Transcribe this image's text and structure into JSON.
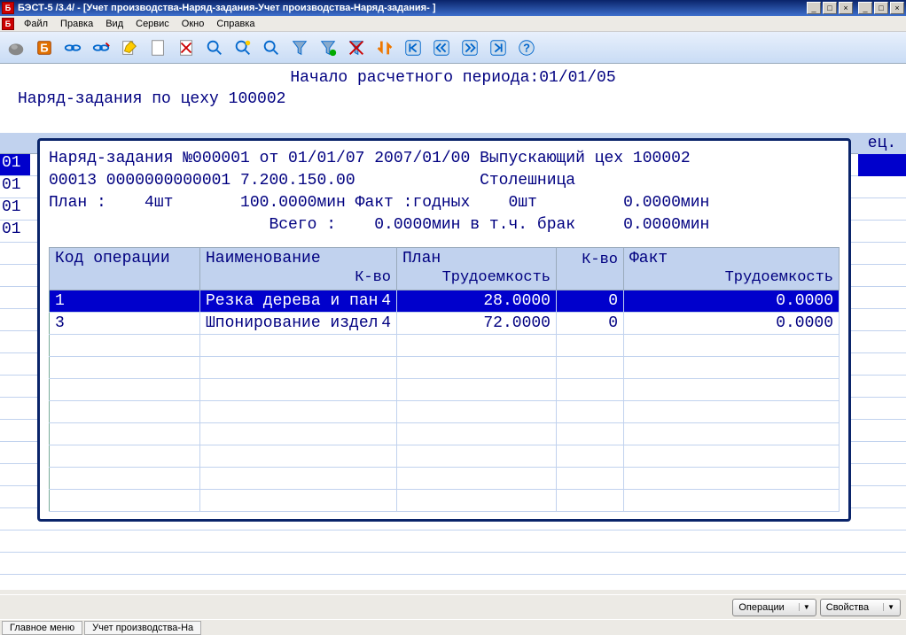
{
  "window": {
    "title": "БЭСТ-5 /3.4/ - [Учет производства-Наряд-задания-Учет производства-Наряд-задания- ]",
    "min": "_",
    "max": "□",
    "close": "×"
  },
  "menu": {
    "file": "Файл",
    "edit": "Правка",
    "view": "Вид",
    "service": "Сервис",
    "window": "Окно",
    "help": "Справка"
  },
  "header": {
    "period": "Начало расчетного периода:01/01/05",
    "cex": "Наряд-задания по цеху 100002"
  },
  "bg": {
    "rows": [
      "01",
      "01",
      "01",
      "01"
    ],
    "right_hdr": "ец."
  },
  "dialog": {
    "line1": "Наряд-задания №000001 от 01/01/07 2007/01/00 Выпускающий цех 100002",
    "line2": "00013 0000000000001 7.200.150.00             Столешница",
    "line3": "План :    4шт       100.0000мин Факт :годных    0шт         0.0000мин",
    "line4": "                       Всего :    0.0000мин в т.ч. брак     0.0000мин"
  },
  "table": {
    "headers": {
      "code": "Код операции",
      "name": "Наименование",
      "plan": "План",
      "fact": "Факт",
      "qty": "К-во",
      "labor": "Трудоемкость"
    },
    "rows": [
      {
        "code": "1",
        "name": "Резка дерева и пан",
        "plan_qty": "4",
        "plan_labor": "28.0000",
        "fact_qty": "0",
        "fact_labor": "0.0000"
      },
      {
        "code": "3",
        "name": "Шпонирование издел",
        "plan_qty": "4",
        "plan_labor": "72.0000",
        "fact_qty": "0",
        "fact_labor": "0.0000"
      }
    ]
  },
  "bottom": {
    "operations": "Операции",
    "props": "Свойства"
  },
  "status": {
    "main": "Главное меню",
    "mod": "Учет производства-На"
  }
}
